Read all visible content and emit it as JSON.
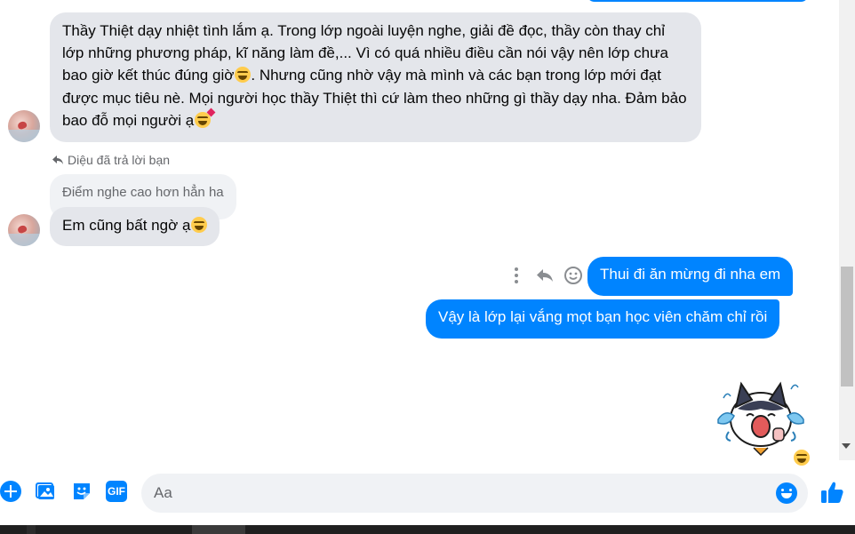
{
  "conversation": {
    "messages_in": [
      {
        "text_parts": [
          "Thầy Thiệt dạy nhiệt tình lắm ạ. Trong lớp ngoài luyện nghe, giải đề đọc, thầy còn thay chỉ lớp những phương pháp, kĩ năng làm đề,... Vì có quá nhiều điều cần nói vậy nên lớp chưa bao giờ kết thúc đúng giờ",
          ". Nhưng cũng nhờ vậy mà mình và các bạn trong lớp mới đạt được mục tiêu nè. Mọi người học thầy Thiệt thì cứ làm theo những gì thầy dạy nha. Đảm bảo bao đỗ mọi người ạ"
        ]
      },
      {
        "reply_label": "Diệu đã trả lời bạn",
        "quoted_text": "Điểm nghe cao hơn hẳn ha",
        "text": "Em cũng bất ngờ ạ"
      }
    ],
    "messages_out": [
      {
        "text": "Thui đi ăn mừng đi nha em"
      },
      {
        "text": "Vậy là lớp lại vắng mọt bạn học viên chăm chỉ rồi"
      }
    ]
  },
  "icons": {
    "laugh_emoji": "laughing-emoji",
    "love_emoji": "smiling-face-with-hearts-emoji",
    "reply": "reply-icon",
    "react": "react-smiley-icon",
    "more": "more-dots-icon"
  },
  "composer": {
    "placeholder": "Aa"
  },
  "colors": {
    "accent": "#0084ff",
    "incoming_bubble": "#e4e6eb",
    "muted_text": "#65676b"
  }
}
